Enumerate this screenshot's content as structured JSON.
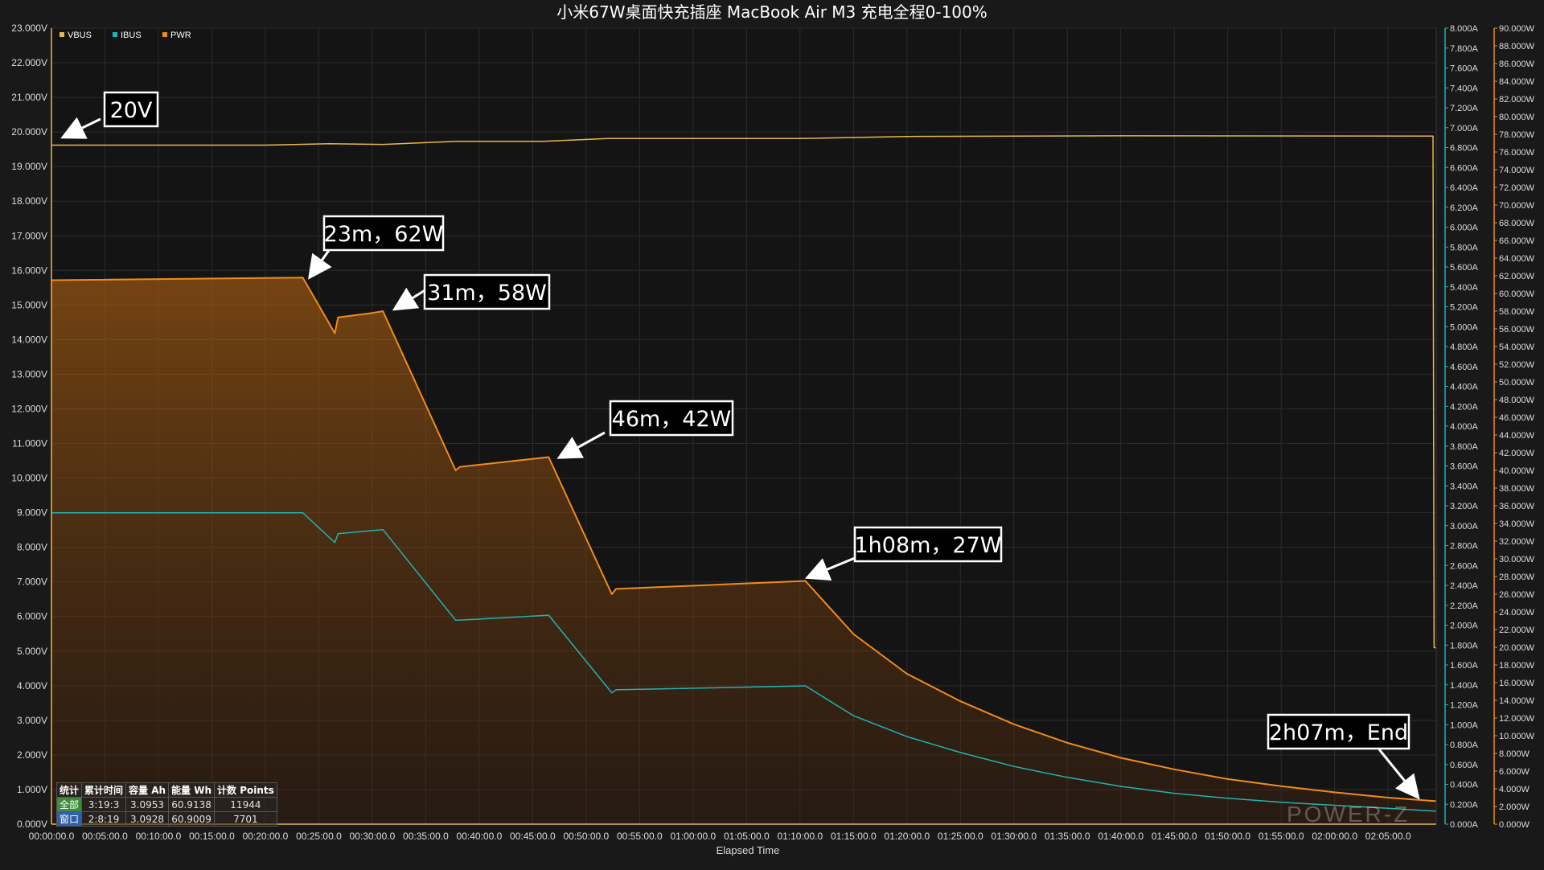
{
  "chart_data": {
    "type": "line",
    "title": "小米67W桌面快充插座 MacBook Air M3 充电全程0-100%",
    "xlabel": "Elapsed Time",
    "x_unit": "minutes",
    "xlim": [
      0,
      129.5
    ],
    "x_ticks": [
      "00:00:00.0",
      "00:05:00.0",
      "00:10:00.0",
      "00:15:00.0",
      "00:20:00.0",
      "00:25:00.0",
      "00:30:00.0",
      "00:35:00.0",
      "00:40:00.0",
      "00:45:00.0",
      "00:50:00.0",
      "00:55:00.0",
      "01:00:00.0",
      "01:05:00.0",
      "01:10:00.0",
      "01:15:00.0",
      "01:20:00.0",
      "01:25:00.0",
      "01:30:00.0",
      "01:35:00.0",
      "01:40:00.0",
      "01:45:00.0",
      "01:50:00.0",
      "01:55:00.0",
      "02:00:00.0",
      "02:05:00.0"
    ],
    "y_left": {
      "ylim": [
        0,
        23
      ],
      "ticks": [
        "0.000V",
        "1.000V",
        "2.000V",
        "3.000V",
        "4.000V",
        "5.000V",
        "6.000V",
        "7.000V",
        "8.000V",
        "9.000V",
        "10.000V",
        "11.000V",
        "12.000V",
        "13.000V",
        "14.000V",
        "15.000V",
        "16.000V",
        "17.000V",
        "18.000V",
        "19.000V",
        "20.000V",
        "21.000V",
        "22.000V",
        "23.000V"
      ]
    },
    "y_mid": {
      "ylim": [
        0,
        8
      ],
      "ticks": [
        "0.000A",
        "0.200A",
        "0.400A",
        "0.600A",
        "0.800A",
        "1.000A",
        "1.200A",
        "1.400A",
        "1.600A",
        "1.800A",
        "2.000A",
        "2.200A",
        "2.400A",
        "2.600A",
        "2.800A",
        "3.000A",
        "3.200A",
        "3.400A",
        "3.600A",
        "3.800A",
        "4.000A",
        "4.200A",
        "4.400A",
        "4.600A",
        "4.800A",
        "5.000A",
        "5.200A",
        "5.400A",
        "5.600A",
        "5.800A",
        "6.000A",
        "6.200A",
        "6.400A",
        "6.600A",
        "6.800A",
        "7.000A",
        "7.200A",
        "7.400A",
        "7.600A",
        "7.800A",
        "8.000A"
      ]
    },
    "y_right": {
      "ylim": [
        0,
        90
      ],
      "ticks": [
        "0.000W",
        "2.000W",
        "4.000W",
        "6.000W",
        "8.000W",
        "10.000W",
        "12.000W",
        "14.000W",
        "16.000W",
        "18.000W",
        "20.000W",
        "22.000W",
        "24.000W",
        "26.000W",
        "28.000W",
        "30.000W",
        "32.000W",
        "34.000W",
        "36.000W",
        "38.000W",
        "40.000W",
        "42.000W",
        "44.000W",
        "46.000W",
        "48.000W",
        "50.000W",
        "52.000W",
        "54.000W",
        "56.000W",
        "58.000W",
        "60.000W",
        "62.000W",
        "64.000W",
        "66.000W",
        "68.000W",
        "70.000W",
        "72.000W",
        "74.000W",
        "76.000W",
        "78.000W",
        "80.000W",
        "82.000W",
        "84.000W",
        "86.000W",
        "88.000W",
        "90.000W"
      ]
    },
    "grid": true,
    "legend": "top-left",
    "series": [
      {
        "name": "VBUS",
        "axis": "left",
        "color": "#e8b84a",
        "x": [
          0,
          20,
          26,
          31,
          38,
          46,
          52,
          70,
          80,
          100,
          129.2,
          129.3,
          129.5
        ],
        "y": [
          19.62,
          19.62,
          19.66,
          19.64,
          19.73,
          19.73,
          19.81,
          19.81,
          19.87,
          19.89,
          19.88,
          5.1,
          5.1
        ]
      },
      {
        "name": "IBUS",
        "axis": "mid",
        "color": "#20b3b3",
        "x": [
          0,
          23.5,
          26.5,
          26.8,
          30,
          31,
          37.8,
          38.2,
          46.5,
          52.4,
          52.8,
          70.5,
          75,
          80,
          85,
          90,
          95,
          100,
          105,
          110,
          115,
          120,
          125,
          129.5
        ],
        "y": [
          3.13,
          3.13,
          2.83,
          2.92,
          2.95,
          2.96,
          2.05,
          2.05,
          2.1,
          1.32,
          1.35,
          1.39,
          1.09,
          0.88,
          0.72,
          0.58,
          0.47,
          0.38,
          0.31,
          0.26,
          0.22,
          0.19,
          0.16,
          0.13
        ]
      },
      {
        "name": "PWR",
        "axis": "right",
        "color": "#f08c1a",
        "fill": true,
        "x": [
          0,
          23.5,
          26.5,
          26.8,
          30,
          31,
          37.8,
          38.2,
          46.5,
          52.4,
          52.8,
          70.5,
          75,
          80,
          85,
          90,
          95,
          100,
          105,
          110,
          115,
          120,
          125,
          129.5
        ],
        "y": [
          61.5,
          61.8,
          55.5,
          57.3,
          57.8,
          58.0,
          40.0,
          40.4,
          41.5,
          26.0,
          26.6,
          27.5,
          21.5,
          17.0,
          13.9,
          11.3,
          9.2,
          7.5,
          6.2,
          5.1,
          4.3,
          3.6,
          3.0,
          2.6
        ]
      }
    ],
    "annotations": [
      {
        "text": "20V"
      },
      {
        "text": "23m，62W"
      },
      {
        "text": "31m，58W"
      },
      {
        "text": "46m，42W"
      },
      {
        "text": "1h08m，27W"
      },
      {
        "text": "2h07m，End"
      }
    ]
  },
  "stats_table": {
    "headers": [
      "统计",
      "累计时间",
      "容量 Ah",
      "能量 Wh",
      "计数 Points"
    ],
    "rows": [
      [
        "全部",
        "3:19:3",
        "3.0953",
        "60.9138",
        "11944"
      ],
      [
        "窗口",
        "2:8:19",
        "3.0928",
        "60.9009",
        "7701"
      ]
    ]
  },
  "watermark": "POWER-Z"
}
